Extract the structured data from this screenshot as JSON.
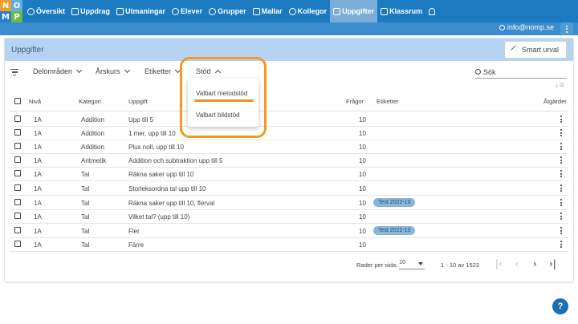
{
  "logo": {
    "letters": [
      "N",
      "O",
      "M",
      "P"
    ]
  },
  "nav": {
    "items": [
      {
        "label": "Översikt",
        "icon": "info-icon",
        "active": false
      },
      {
        "label": "Uppdrag",
        "icon": "calendar-icon",
        "active": false
      },
      {
        "label": "Utmaningar",
        "icon": "trophy-icon",
        "active": false
      },
      {
        "label": "Elever",
        "icon": "person-icon",
        "active": false
      },
      {
        "label": "Grupper",
        "icon": "group-icon",
        "active": false
      },
      {
        "label": "Mallar",
        "icon": "folder-icon",
        "active": false
      },
      {
        "label": "Kollegor",
        "icon": "people-icon",
        "active": false
      },
      {
        "label": "Uppgifter",
        "icon": "grid-icon",
        "active": true
      },
      {
        "label": "Klassrum",
        "icon": "classroom-icon",
        "active": false
      }
    ]
  },
  "user": {
    "email": "info@nomp.se"
  },
  "card": {
    "title": "Uppgifter",
    "smart_button": "Smart urval"
  },
  "filters": {
    "items": [
      "Delområden",
      "Årskurs",
      "Etiketter",
      "Stöd"
    ],
    "search_placeholder": "Sök"
  },
  "dropdown": {
    "items": [
      "Valbart metodstöd",
      "Valbart bildstöd"
    ]
  },
  "table": {
    "headers": {
      "level": "Nivå",
      "category": "Kategori",
      "task": "Uppgift",
      "questions": "Frågor",
      "tags": "Etiketter",
      "actions": "Åtgärder"
    },
    "rows": [
      {
        "level": "1A",
        "category": "Addition",
        "task": "Upp till 5",
        "questions": "10",
        "tag": ""
      },
      {
        "level": "1A",
        "category": "Addition",
        "task": "1 mer, upp till 10",
        "questions": "10",
        "tag": ""
      },
      {
        "level": "1A",
        "category": "Addition",
        "task": "Plus noll, upp till 10",
        "questions": "10",
        "tag": ""
      },
      {
        "level": "1A",
        "category": "Aritmetik",
        "task": "Addition och subtraktion upp till 5",
        "questions": "10",
        "tag": ""
      },
      {
        "level": "1A",
        "category": "Tal",
        "task": "Räkna saker upp till 10",
        "questions": "10",
        "tag": ""
      },
      {
        "level": "1A",
        "category": "Tal",
        "task": "Storleksordna tal upp till 10",
        "questions": "10",
        "tag": ""
      },
      {
        "level": "1A",
        "category": "Tal",
        "task": "Räkna saker upp till 10, flerval",
        "questions": "10",
        "tag": "Test 2022-10"
      },
      {
        "level": "1A",
        "category": "Tal",
        "task": "Vilket tal? (upp till 10)",
        "questions": "10",
        "tag": ""
      },
      {
        "level": "1A",
        "category": "Tal",
        "task": "Fler",
        "questions": "10",
        "tag": "Test 2022-10"
      },
      {
        "level": "1A",
        "category": "Tal",
        "task": "Färre",
        "questions": "10",
        "tag": ""
      }
    ]
  },
  "pagination": {
    "rows_per_page_label": "Rader per sida:",
    "rows_per_page": "10",
    "range": "1 - 10 av 1523"
  },
  "help": {
    "label": "?"
  },
  "colors": {
    "nav": "#1c7bc0",
    "header": "#b7d3f4",
    "highlight": "#f39a1f",
    "tag": "#8ab6d9"
  }
}
